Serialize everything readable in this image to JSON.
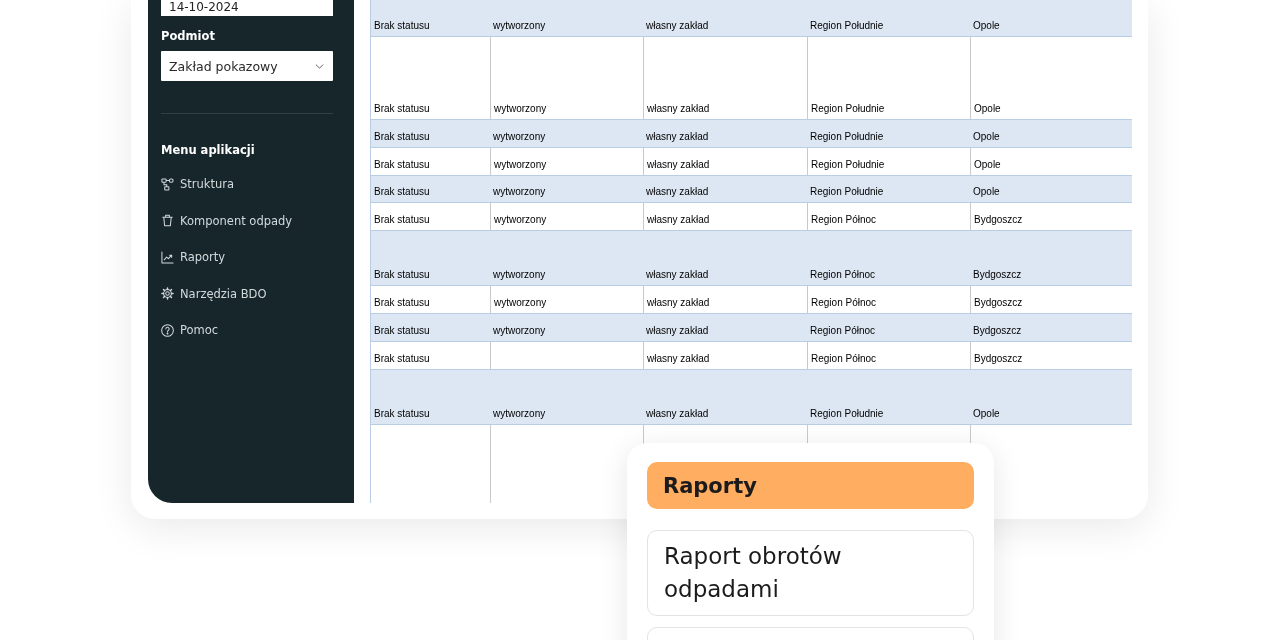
{
  "sidebar": {
    "date_field": {
      "value": "14-10-2024"
    },
    "entity_field": {
      "label": "Podmiot",
      "value": "Zakład pokazowy"
    },
    "menu": {
      "title": "Menu aplikacji",
      "items": [
        {
          "label": "Struktura"
        },
        {
          "label": "Komponent odpady"
        },
        {
          "label": "Raporty"
        },
        {
          "label": "Narzędzia BDO"
        },
        {
          "label": "Pomoc"
        }
      ]
    }
  },
  "table": {
    "rows": [
      {
        "column_1": "Brak statusu",
        "column_2": "wytworzony",
        "column_3": "własny zakład",
        "column_4": "Region Południe",
        "column_5": "Opole"
      },
      {
        "column_1": "Brak statusu",
        "column_2": "wytworzony",
        "column_3": "własny zakład",
        "column_4": "Region Południe",
        "column_5": "Opole"
      },
      {
        "column_1": "Brak statusu",
        "column_2": "wytworzony",
        "column_3": "własny zakład",
        "column_4": "Region Południe",
        "column_5": "Opole"
      },
      {
        "column_1": "Brak statusu",
        "column_2": "wytworzony",
        "column_3": "własny zakład",
        "column_4": "Region Południe",
        "column_5": "Opole"
      },
      {
        "column_1": "Brak statusu",
        "column_2": "wytworzony",
        "column_3": "własny zakład",
        "column_4": "Region Południe",
        "column_5": "Opole"
      },
      {
        "column_1": "Brak statusu",
        "column_2": "wytworzony",
        "column_3": "własny zakład",
        "column_4": "Region Północ",
        "column_5": "Bydgoszcz"
      },
      {
        "column_1": "Brak statusu",
        "column_2": "wytworzony",
        "column_3": "własny zakład",
        "column_4": "Region Północ",
        "column_5": "Bydgoszcz"
      },
      {
        "column_1": "Brak statusu",
        "column_2": "wytworzony",
        "column_3": "własny zakład",
        "column_4": "Region Północ",
        "column_5": "Bydgoszcz"
      },
      {
        "column_1": "Brak statusu",
        "column_2": "wytworzony",
        "column_3": "własny zakład",
        "column_4": "Region Północ",
        "column_5": "Bydgoszcz"
      },
      {
        "column_1": "Brak statusu",
        "column_3": "własny zakład",
        "column_4": "Region Północ",
        "column_5": "Bydgoszcz"
      },
      {
        "column_1": "Brak statusu",
        "column_2": "wytworzony",
        "column_3": "własny zakład",
        "column_4": "Region Południe",
        "column_5": "Opole"
      }
    ]
  },
  "popup": {
    "title": "Raporty",
    "options": [
      {
        "label": "Raport obrotów odpadami"
      }
    ]
  }
}
